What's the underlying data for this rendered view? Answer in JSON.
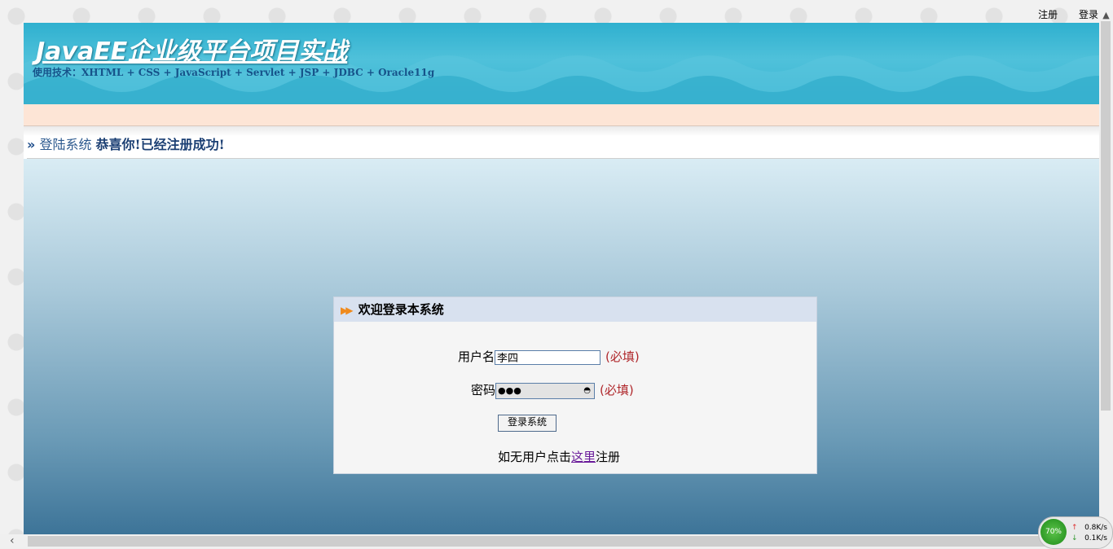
{
  "top_links": {
    "register": "注册",
    "login": "登录"
  },
  "banner": {
    "title": "JavaEE企业级平台项目实战",
    "subtitle": "使用技术：XHTML + CSS + JavaScript + Servlet + JSP + JDBC + Oracle11g"
  },
  "breadcrumb": {
    "arrow": "»",
    "section": "登陆系统",
    "message": "恭喜你!已经注册成功!"
  },
  "login_panel": {
    "title": "欢迎登录本系统",
    "username_label": "用户名",
    "username_value": "李四",
    "username_required": "(必填)",
    "password_label": "密码",
    "password_mask": "●●●",
    "password_required": "(必填)",
    "submit_label": "登录系统",
    "register_prefix": "如无用户点击",
    "register_link": "这里",
    "register_suffix": "注册"
  },
  "net_monitor": {
    "percent": "70%",
    "upload": "0.8K/s",
    "download": "0.1K/s"
  },
  "colors": {
    "banner": "#39b4d3",
    "peach": "#fde5d6",
    "required": "#b0282c",
    "panel_head": "#d8e1ef"
  }
}
